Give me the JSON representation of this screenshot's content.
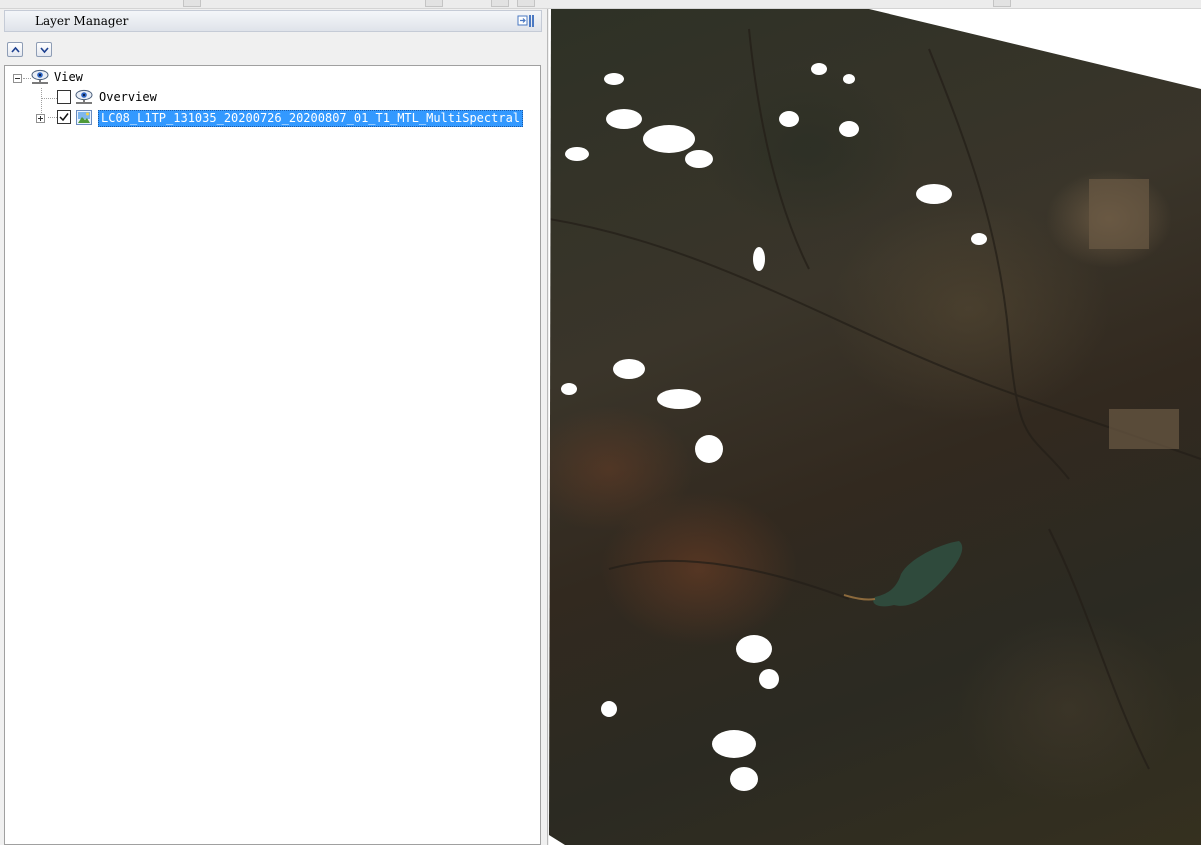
{
  "panel": {
    "title": "Layer Manager"
  },
  "tree": {
    "root": {
      "label": "View",
      "expanded": true
    },
    "items": [
      {
        "label": "Overview",
        "checked": false,
        "icon": "eye-icon",
        "selected": false
      },
      {
        "label": "LC08_L1TP_131035_20200726_20200807_01_T1_MTL_MultiSpectral",
        "checked": true,
        "icon": "raster-image-icon",
        "selected": true,
        "expanded": false
      }
    ]
  },
  "toolbar": {
    "move_up_icon": "move-up-icon",
    "move_down_icon": "move-down-icon",
    "dock_icon": "dock-pin-icon"
  },
  "colors": {
    "selection": "#3399ff",
    "panel_bg": "#f0f0f0"
  }
}
